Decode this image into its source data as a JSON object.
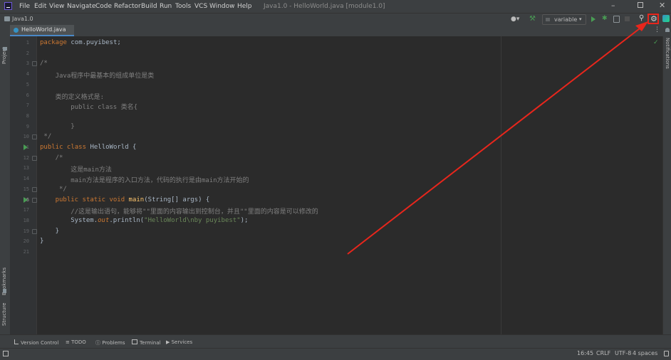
{
  "window": {
    "title": "Java1.0 - HelloWorld.java [module1.0]",
    "menu": [
      "File",
      "Edit",
      "View",
      "Navigate",
      "Code",
      "Refactor",
      "Build",
      "Run",
      "Tools",
      "VCS",
      "Window",
      "Help"
    ]
  },
  "navbar": {
    "project": "Java1.0",
    "run_config": "variable"
  },
  "tab": {
    "label": "HelloWorld.java"
  },
  "side_panels": {
    "project": "Project",
    "bookmarks": "Bookmarks",
    "structure": "Structure",
    "notifications": "Notifications"
  },
  "editor": {
    "line_numbers": [
      "1",
      "2",
      "3",
      "4",
      "5",
      "6",
      "7",
      "8",
      "9",
      "10",
      "11",
      "12",
      "13",
      "14",
      "15",
      "16",
      "17",
      "18",
      "19",
      "20",
      "21"
    ],
    "current_line": "16",
    "lines": [
      {
        "indent": 0,
        "parts": [
          {
            "t": "package ",
            "c": "kw"
          },
          {
            "t": "com.puyibest;",
            "c": ""
          }
        ]
      },
      {
        "indent": 0,
        "parts": []
      },
      {
        "indent": 0,
        "parts": [
          {
            "t": "/*",
            "c": "cm"
          }
        ]
      },
      {
        "indent": 2,
        "parts": [
          {
            "t": "Java程序中最基本的组成单位是类",
            "c": "cm"
          }
        ]
      },
      {
        "indent": 0,
        "parts": []
      },
      {
        "indent": 2,
        "parts": [
          {
            "t": "类的定义格式是:",
            "c": "cm"
          }
        ]
      },
      {
        "indent": 4,
        "parts": [
          {
            "t": "public class 类名{",
            "c": "cm"
          }
        ]
      },
      {
        "indent": 0,
        "parts": []
      },
      {
        "indent": 4,
        "parts": [
          {
            "t": "}",
            "c": "cm"
          }
        ]
      },
      {
        "indent": 0,
        "parts": [
          {
            "t": " */",
            "c": "cm"
          }
        ]
      },
      {
        "indent": 0,
        "parts": [
          {
            "t": "public class ",
            "c": "kw"
          },
          {
            "t": "HelloWorld {",
            "c": ""
          }
        ]
      },
      {
        "indent": 2,
        "parts": [
          {
            "t": "/*",
            "c": "cm"
          }
        ]
      },
      {
        "indent": 4,
        "parts": [
          {
            "t": "这是main方法",
            "c": "cm"
          }
        ]
      },
      {
        "indent": 4,
        "parts": [
          {
            "t": "main方法是程序的入口方法，代码的执行是由main方法开始的",
            "c": "cm"
          }
        ]
      },
      {
        "indent": 2,
        "parts": [
          {
            "t": " */",
            "c": "cm"
          }
        ]
      },
      {
        "indent": 2,
        "parts": [
          {
            "t": "public static void ",
            "c": "kw"
          },
          {
            "t": "main",
            "c": "fn"
          },
          {
            "t": "(String[] args) {",
            "c": ""
          }
        ]
      },
      {
        "indent": 4,
        "parts": [
          {
            "t": "//这是输出语句，能够将\"\"里面的内容输出到控制台，并且\"\"里面的内容是可以修改的",
            "c": "cm"
          }
        ]
      },
      {
        "indent": 4,
        "parts": [
          {
            "t": "System.",
            "c": ""
          },
          {
            "t": "out",
            "c": "kw it"
          },
          {
            "t": ".println(",
            "c": ""
          },
          {
            "t": "\"HelloWorld\\nby puyibest\"",
            "c": "str"
          },
          {
            "t": ");",
            "c": ""
          }
        ]
      },
      {
        "indent": 2,
        "parts": [
          {
            "t": "}",
            "c": ""
          }
        ]
      },
      {
        "indent": 0,
        "parts": [
          {
            "t": "}",
            "c": ""
          }
        ]
      },
      {
        "indent": 0,
        "parts": []
      }
    ],
    "run_marker_lines": [
      "11",
      "16"
    ]
  },
  "tool_windows": [
    "Version Control",
    "TODO",
    "Problems",
    "Terminal",
    "Services"
  ],
  "status": {
    "time": "16:45",
    "line_sep": "CRLF",
    "encoding": "UTF-8",
    "indent": "4 spaces"
  },
  "colors": {
    "annotation_red": "#e8261c",
    "run_green": "#499c54",
    "accent_blue": "#3592c4"
  }
}
